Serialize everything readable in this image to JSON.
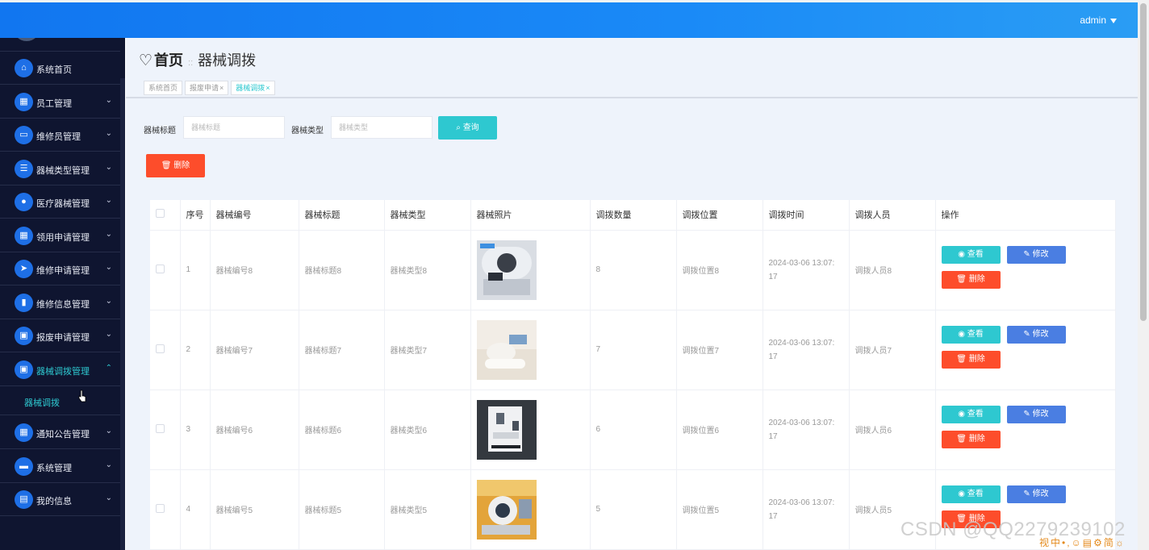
{
  "header": {
    "user": "admin"
  },
  "sidebar": {
    "items": [
      {
        "label": "系统首页",
        "icon": "home-icon",
        "glyph": "⌂",
        "expandable": false
      },
      {
        "label": "员工管理",
        "icon": "grid-icon",
        "glyph": "▦",
        "expandable": true
      },
      {
        "label": "维修员管理",
        "icon": "monitor-icon",
        "glyph": "▭",
        "expandable": true
      },
      {
        "label": "器械类型管理",
        "icon": "sliders-icon",
        "glyph": "☰",
        "expandable": true
      },
      {
        "label": "医疗器械管理",
        "icon": "bulb-icon",
        "glyph": "●",
        "expandable": true
      },
      {
        "label": "领用申请管理",
        "icon": "grid-icon",
        "glyph": "▦",
        "expandable": true
      },
      {
        "label": "维修申请管理",
        "icon": "send-icon",
        "glyph": "➤",
        "expandable": true
      },
      {
        "label": "维修信息管理",
        "icon": "chart-icon",
        "glyph": "▮",
        "expandable": true
      },
      {
        "label": "报废申请管理",
        "icon": "clipboard-icon",
        "glyph": "▣",
        "expandable": true
      },
      {
        "label": "器械调拨管理",
        "icon": "clipboard-icon",
        "glyph": "▣",
        "expandable": true,
        "open": true
      },
      {
        "label": "通知公告管理",
        "icon": "grid-icon",
        "glyph": "▦",
        "expandable": true
      },
      {
        "label": "系统管理",
        "icon": "chat-icon",
        "glyph": "▬",
        "expandable": true
      },
      {
        "label": "我的信息",
        "icon": "card-icon",
        "glyph": "▤",
        "expandable": true
      }
    ],
    "submenu": {
      "label": "器械调拨"
    }
  },
  "page": {
    "home": "首页",
    "current": "器械调拨"
  },
  "tabs": [
    {
      "label": "系统首页",
      "closable": false
    },
    {
      "label": "报废申请",
      "closable": true
    },
    {
      "label": "器械调拨",
      "closable": true,
      "active": true
    }
  ],
  "search": {
    "title_label": "器械标题",
    "title_placeholder": "器械标题",
    "type_label": "器械类型",
    "type_placeholder": "器械类型",
    "query_button": "查询",
    "delete_button": "删除"
  },
  "table": {
    "columns": [
      "序号",
      "器械编号",
      "器械标题",
      "器械类型",
      "器械照片",
      "调拨数量",
      "调拨位置",
      "调拨时间",
      "调拨人员",
      "操作"
    ],
    "rows": [
      {
        "index": "1",
        "code": "器械编号8",
        "title": "器械标题8",
        "type": "器械类型8",
        "quantity": "8",
        "location": "调拨位置8",
        "time_a": "2024-03-06 13:07:",
        "time_b": "17",
        "person": "调拨人员8"
      },
      {
        "index": "2",
        "code": "器械编号7",
        "title": "器械标题7",
        "type": "器械类型7",
        "quantity": "7",
        "location": "调拨位置7",
        "time_a": "2024-03-06 13:07:",
        "time_b": "17",
        "person": "调拨人员7"
      },
      {
        "index": "3",
        "code": "器械编号6",
        "title": "器械标题6",
        "type": "器械类型6",
        "quantity": "6",
        "location": "调拨位置6",
        "time_a": "2024-03-06 13:07:",
        "time_b": "17",
        "person": "调拨人员6"
      },
      {
        "index": "4",
        "code": "器械编号5",
        "title": "器械标题5",
        "type": "器械类型5",
        "quantity": "5",
        "location": "调拨位置5",
        "time_a": "2024-03-06 13:07:",
        "time_b": "17",
        "person": "调拨人员5"
      }
    ],
    "actions": {
      "view": "查看",
      "edit": "修改",
      "delete": "删除"
    }
  },
  "colors": {
    "accent": "#2ec8d0",
    "header": "#1176f0",
    "sidebar": "#0f1530",
    "danger": "#fd4d2b",
    "primary": "#4a7ee2"
  },
  "watermark": "CSDN @QQ2279239102",
  "ime_bar": "视中•,☺▤⚙简☼"
}
